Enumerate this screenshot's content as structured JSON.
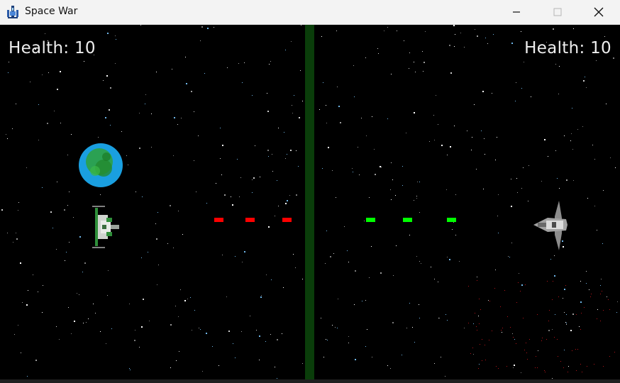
{
  "window": {
    "title": "Space War",
    "icons": {
      "app": "spaceship-app-icon",
      "minimize": "minimize-icon",
      "maximize": "maximize-icon",
      "close": "close-icon"
    }
  },
  "game": {
    "left_player": {
      "health_label": "Health: 10",
      "ship": "green-white-fighter"
    },
    "right_player": {
      "health_label": "Health: 10",
      "ship": "grey-fighter"
    },
    "colors": {
      "space": "#000000",
      "divider": "#0a3d0a",
      "left_bullets": "#ff0000",
      "right_bullets": "#00ff00",
      "planet_ocean": "#1a9fe0",
      "planet_land": "#2fa13a"
    },
    "bullets": {
      "red_count": 3,
      "green_count": 3
    }
  }
}
